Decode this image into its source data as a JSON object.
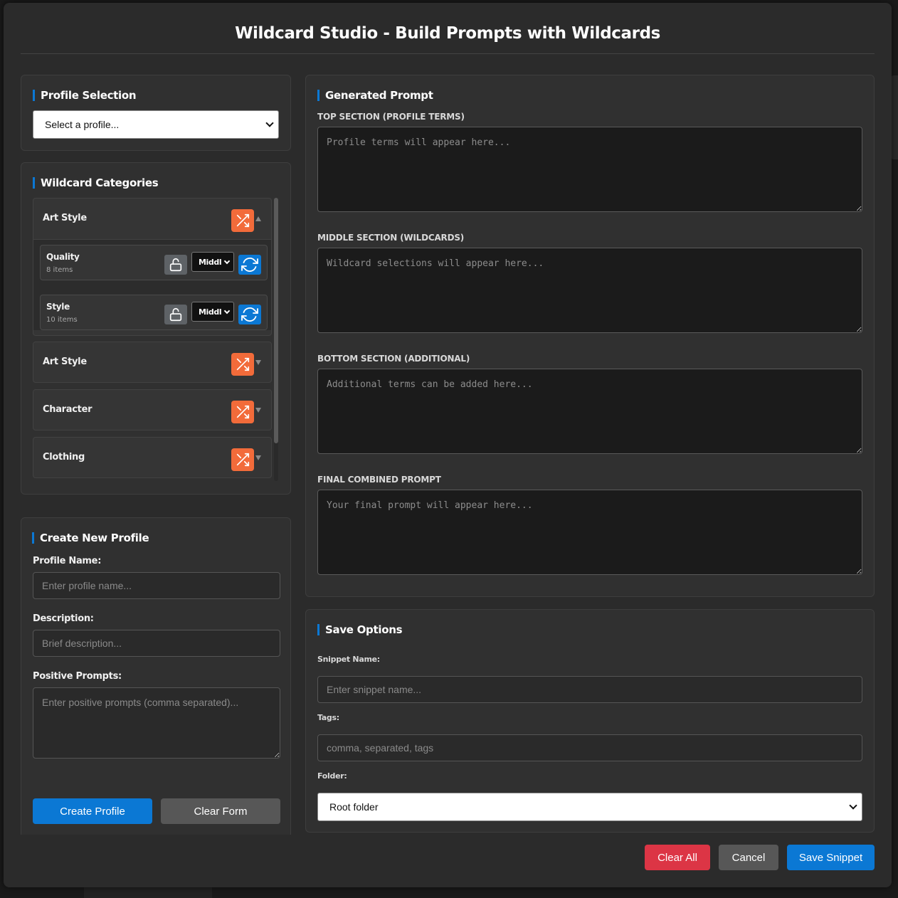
{
  "modal": {
    "title": "Wildcard Studio - Build Prompts with Wildcards"
  },
  "profile_selection": {
    "heading": "Profile Selection",
    "select_value": "Select a profile..."
  },
  "wildcard_categories": {
    "heading": "Wildcard Categories",
    "groups": [
      {
        "title": "Art Style",
        "expanded": true,
        "items": [
          {
            "name": "Quality",
            "count": "8 items",
            "position": "Middl"
          },
          {
            "name": "Style",
            "count": "10 items",
            "position": "Middl"
          }
        ]
      },
      {
        "title": "Art Style",
        "expanded": false
      },
      {
        "title": "Character",
        "expanded": false
      },
      {
        "title": "Clothing",
        "expanded": false
      }
    ]
  },
  "create_profile": {
    "heading": "Create New Profile",
    "name_label": "Profile Name:",
    "name_placeholder": "Enter profile name...",
    "desc_label": "Description:",
    "desc_placeholder": "Brief description...",
    "prompts_label": "Positive Prompts:",
    "prompts_placeholder": "Enter positive prompts (comma separated)...",
    "create_button": "Create Profile",
    "clear_button": "Clear Form"
  },
  "generated_prompt": {
    "heading": "Generated Prompt",
    "sections": [
      {
        "label": "Top Section (Profile Terms)",
        "placeholder": "Profile terms will appear here..."
      },
      {
        "label": "Middle Section (Wildcards)",
        "placeholder": "Wildcard selections will appear here..."
      },
      {
        "label": "Bottom Section (Additional)",
        "placeholder": "Additional terms can be added here..."
      },
      {
        "label": "Final Combined Prompt",
        "placeholder": "Your final prompt will appear here..."
      }
    ]
  },
  "save_options": {
    "heading": "Save Options",
    "snippet_label": "Snippet Name:",
    "snippet_placeholder": "Enter snippet name...",
    "tags_label": "Tags:",
    "tags_placeholder": "comma, separated, tags",
    "folder_label": "Folder:",
    "folder_value": "Root folder"
  },
  "footer": {
    "clear_all": "Clear All",
    "cancel": "Cancel",
    "save_snippet": "Save Snippet"
  },
  "colors": {
    "accent": "#0b78d4",
    "shuffle": "#f26b3a",
    "danger": "#dc3545",
    "neutral_button": "#575757",
    "lock": "#5e6266"
  },
  "icons": {
    "shuffle": "shuffle-icon",
    "lock": "unlock-icon",
    "refresh": "refresh-icon",
    "chevron": "chevron-down-icon"
  }
}
